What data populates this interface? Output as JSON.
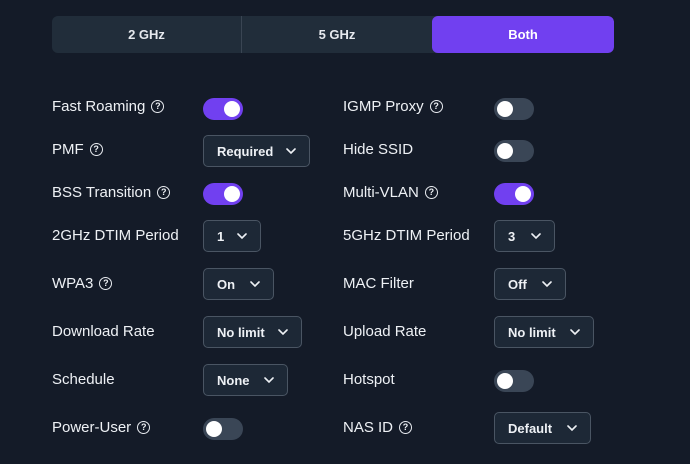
{
  "band_tabs": [
    "2 GHz",
    "5 GHz",
    "Both"
  ],
  "selected_band": "Both",
  "colors": {
    "accent": "#7140f0",
    "background": "#141b28",
    "toggle_off": "#3a4656"
  },
  "settings_left": [
    {
      "label": "Fast Roaming",
      "help": true,
      "control": "toggle",
      "value": "on"
    },
    {
      "label": "PMF",
      "help": true,
      "control": "select",
      "value": "Required"
    },
    {
      "label": "BSS Transition",
      "help": true,
      "control": "toggle",
      "value": "on"
    },
    {
      "label": "2GHz DTIM Period",
      "help": false,
      "control": "select",
      "value": "1"
    },
    {
      "label": "WPA3",
      "help": true,
      "control": "select",
      "value": "On"
    },
    {
      "label": "Download Rate",
      "help": false,
      "control": "select",
      "value": "No limit"
    },
    {
      "label": "Schedule",
      "help": false,
      "control": "select",
      "value": "None"
    },
    {
      "label": "Power-User",
      "help": true,
      "control": "toggle",
      "value": "off"
    }
  ],
  "settings_right": [
    {
      "label": "IGMP Proxy",
      "help": true,
      "control": "toggle",
      "value": "off"
    },
    {
      "label": "Hide SSID",
      "help": false,
      "control": "toggle",
      "value": "off"
    },
    {
      "label": "Multi-VLAN",
      "help": true,
      "control": "toggle",
      "value": "on"
    },
    {
      "label": "5GHz DTIM Period",
      "help": false,
      "control": "select",
      "value": "3"
    },
    {
      "label": "MAC Filter",
      "help": false,
      "control": "select",
      "value": "Off"
    },
    {
      "label": "Upload Rate",
      "help": false,
      "control": "select",
      "value": "No limit"
    },
    {
      "label": "Hotspot",
      "help": false,
      "control": "toggle",
      "value": "off"
    },
    {
      "label": "NAS ID",
      "help": true,
      "control": "select",
      "value": "Default"
    }
  ],
  "icons": {
    "help": "question-circle-icon",
    "dropdown": "chevron-down-icon"
  }
}
